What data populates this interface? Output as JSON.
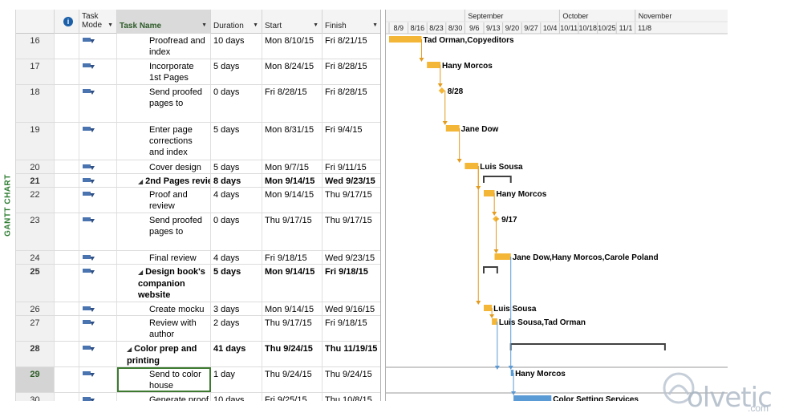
{
  "view_label": "GANTT CHART",
  "columns": {
    "task_mode": "Task Mode",
    "task_name": "Task Name",
    "duration": "Duration",
    "start": "Start",
    "finish": "Finish"
  },
  "timescale": {
    "months": [
      {
        "label": "September",
        "week_index": 4
      },
      {
        "label": "October",
        "week_index": 9
      },
      {
        "label": "November",
        "week_index": 13
      }
    ],
    "weeks": [
      "8/9",
      "8/16",
      "8/23",
      "8/30",
      "9/6",
      "9/13",
      "9/20",
      "9/27",
      "10/4",
      "10/11",
      "10/18",
      "10/25",
      "11/1",
      "11/8"
    ]
  },
  "tasks": [
    {
      "id": "16",
      "name": "Proofread and index",
      "duration": "10 days",
      "start": "Mon 8/10/15",
      "finish": "Fri 8/21/15",
      "indent": 3,
      "summary": false,
      "lines": 2,
      "type": "task",
      "bar_start": 1,
      "bar_end": 12,
      "resources": "Tad Orman,Copyeditors"
    },
    {
      "id": "17",
      "name": "Incorporate 1st Pages",
      "duration": "5 days",
      "start": "Mon 8/24/15",
      "finish": "Fri 8/28/15",
      "indent": 3,
      "summary": false,
      "lines": 2,
      "type": "task",
      "bar_start": 15,
      "bar_end": 19,
      "resources": "Hany Morcos"
    },
    {
      "id": "18",
      "name": "Send proofed pages to",
      "duration": "0 days",
      "start": "Fri 8/28/15",
      "finish": "Fri 8/28/15",
      "indent": 3,
      "summary": false,
      "lines": 3,
      "type": "milestone",
      "bar_start": 19.5,
      "bar_end": 19.5,
      "resources": "8/28"
    },
    {
      "id": "19",
      "name": "Enter page corrections and index",
      "duration": "5 days",
      "start": "Mon 8/31/15",
      "finish": "Fri 9/4/15",
      "indent": 3,
      "summary": false,
      "lines": 3,
      "type": "task",
      "bar_start": 22,
      "bar_end": 26,
      "resources": "Jane Dow"
    },
    {
      "id": "20",
      "name": "Cover design",
      "duration": "5 days",
      "start": "Mon 9/7/15",
      "finish": "Fri 9/11/15",
      "indent": 3,
      "summary": false,
      "lines": 1,
      "type": "task",
      "bar_start": 29,
      "bar_end": 33,
      "resources": "Luis Sousa"
    },
    {
      "id": "21",
      "name": "2nd Pages revie",
      "duration": "8 days",
      "start": "Mon 9/14/15",
      "finish": "Wed 9/23/15",
      "indent": 2,
      "summary": true,
      "lines": 1,
      "type": "summary",
      "bar_start": 36,
      "bar_end": 45,
      "resources": ""
    },
    {
      "id": "22",
      "name": "Proof and review",
      "duration": "4 days",
      "start": "Mon 9/14/15",
      "finish": "Thu 9/17/15",
      "indent": 3,
      "summary": false,
      "lines": 2,
      "type": "task",
      "bar_start": 36,
      "bar_end": 39,
      "resources": "Hany Morcos"
    },
    {
      "id": "23",
      "name": "Send proofed pages to",
      "duration": "0 days",
      "start": "Thu 9/17/15",
      "finish": "Thu 9/17/15",
      "indent": 3,
      "summary": false,
      "lines": 3,
      "type": "milestone",
      "bar_start": 39.5,
      "bar_end": 39.5,
      "resources": "9/17"
    },
    {
      "id": "24",
      "name": "Final review",
      "duration": "4 days",
      "start": "Fri 9/18/15",
      "finish": "Wed 9/23/15",
      "indent": 3,
      "summary": false,
      "lines": 1,
      "type": "task",
      "bar_start": 40,
      "bar_end": 45,
      "resources": "Jane Dow,Hany Morcos,Carole Poland"
    },
    {
      "id": "25",
      "name": "Design book's companion website",
      "duration": "5 days",
      "start": "Mon 9/14/15",
      "finish": "Fri 9/18/15",
      "indent": 2,
      "summary": true,
      "lines": 3,
      "type": "summary",
      "bar_start": 36,
      "bar_end": 40,
      "resources": ""
    },
    {
      "id": "26",
      "name": "Create mocku",
      "duration": "3 days",
      "start": "Mon 9/14/15",
      "finish": "Wed 9/16/15",
      "indent": 3,
      "summary": false,
      "lines": 1,
      "type": "task",
      "bar_start": 36,
      "bar_end": 38,
      "resources": "Luis Sousa"
    },
    {
      "id": "27",
      "name": "Review with author",
      "duration": "2 days",
      "start": "Thu 9/17/15",
      "finish": "Fri 9/18/15",
      "indent": 3,
      "summary": false,
      "lines": 2,
      "type": "task",
      "bar_start": 39,
      "bar_end": 40,
      "resources": "Luis Sousa,Tad Orman"
    },
    {
      "id": "28",
      "name": "Color prep and printing",
      "duration": "41 days",
      "start": "Thu 9/24/15",
      "finish": "Thu 11/19/15",
      "indent": 1,
      "summary": true,
      "lines": 2,
      "type": "summary",
      "bar_start": 46,
      "bar_end": 102,
      "resources": ""
    },
    {
      "id": "29",
      "name": "Send to color house",
      "duration": "1 day",
      "start": "Thu 9/24/15",
      "finish": "Thu 9/24/15",
      "indent": 3,
      "summary": false,
      "lines": 2,
      "type": "task",
      "bar_start": 46,
      "bar_end": 46,
      "resources": "Hany Morcos",
      "selected": true,
      "color": "#5b9bd5"
    },
    {
      "id": "30",
      "name": "Generate proof",
      "duration": "10 days",
      "start": "Fri 9/25/15",
      "finish": "Thu 10/8/15",
      "indent": 3,
      "summary": false,
      "lines": 1,
      "type": "task",
      "bar_start": 47,
      "bar_end": 60,
      "resources": "Color Setting Services",
      "color": "#5b9bd5"
    }
  ],
  "colors": {
    "task_bar": "#f4b636",
    "task_bar_blue": "#5b9bd5",
    "summary_bar": "#404040",
    "link": "#e39b1e",
    "accent_green": "#2e7d32"
  },
  "watermark": {
    "brand": "olvetic",
    "suffix": ".com"
  }
}
